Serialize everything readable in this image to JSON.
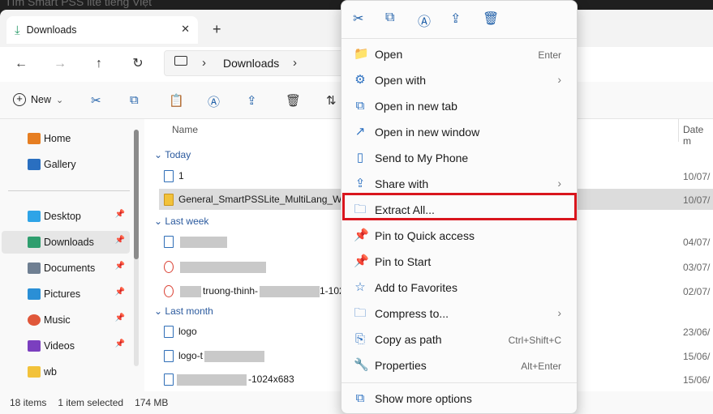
{
  "background_title": "Tìm Smart PSS lite tiếng Việt",
  "tab": {
    "title": "Downloads",
    "close": "✕",
    "new_tab": "+"
  },
  "nav": {
    "back": "←",
    "forward": "→",
    "up": "↑",
    "refresh": "↻",
    "breadcrumb": "Downloads",
    "sep1": "›",
    "sep2": "›"
  },
  "toolbar": {
    "new_label": "New",
    "new_caret": "⌄"
  },
  "sidebar": {
    "items": [
      {
        "label": "Home",
        "color": "#e67e22"
      },
      {
        "label": "Gallery",
        "color": "#2a6fc0"
      },
      {
        "label": "Desktop",
        "color": "#2fa4e7"
      },
      {
        "label": "Downloads",
        "color": "#2f9e6e"
      },
      {
        "label": "Documents",
        "color": "#6f7f92"
      },
      {
        "label": "Pictures",
        "color": "#2a8fd6"
      },
      {
        "label": "Music",
        "color": "#e0573a"
      },
      {
        "label": "Videos",
        "color": "#7b3fbf"
      },
      {
        "label": "wb",
        "color": "#f2c23a"
      }
    ]
  },
  "columns": {
    "name": "Name",
    "date": "Date m"
  },
  "groups": {
    "today": "Today",
    "last_week": "Last week",
    "last_month": "Last month"
  },
  "files": [
    {
      "name": "1",
      "date": "10/07/"
    },
    {
      "name": "General_SmartPSSLite_MultiLang_Win",
      "date": "10/07/"
    },
    {
      "name": "",
      "date": "04/07/"
    },
    {
      "name": "",
      "date": "03/07/"
    },
    {
      "name": "truong-thinh-",
      "name_suffix": "1-102",
      "date": "02/07/"
    },
    {
      "name": "logo",
      "date": "23/06/"
    },
    {
      "name": "logo-t",
      "date": "15/06/"
    },
    {
      "name": "-1024x683",
      "date": "15/06/"
    }
  ],
  "status": {
    "items": "18 items",
    "selected": "1 item selected",
    "size": "174 MB"
  },
  "context_menu": {
    "items": [
      {
        "label": "Open",
        "shortcut": "Enter",
        "icon": "📁"
      },
      {
        "label": "Open with",
        "arrow": "›",
        "icon": "⚙"
      },
      {
        "label": "Open in new tab",
        "icon": "⧉"
      },
      {
        "label": "Open in new window",
        "icon": "↗"
      },
      {
        "label": "Send to My Phone",
        "icon": "▯"
      },
      {
        "label": "Share with",
        "arrow": "›",
        "icon": "⇪"
      },
      {
        "label": "Extract All...",
        "icon": "🗀"
      },
      {
        "label": "Pin to Quick access",
        "icon": "📌"
      },
      {
        "label": "Pin to Start",
        "icon": "📌"
      },
      {
        "label": "Add to Favorites",
        "icon": "☆"
      },
      {
        "label": "Compress to...",
        "arrow": "›",
        "icon": "🗀"
      },
      {
        "label": "Copy as path",
        "shortcut": "Ctrl+Shift+C",
        "icon": "⎘"
      },
      {
        "label": "Properties",
        "shortcut": "Alt+Enter",
        "icon": "🔧"
      },
      {
        "label": "Show more options",
        "icon": "⧉"
      }
    ]
  },
  "colors": {
    "highlight": "#d9151d",
    "accent": "#2a6fc0"
  }
}
